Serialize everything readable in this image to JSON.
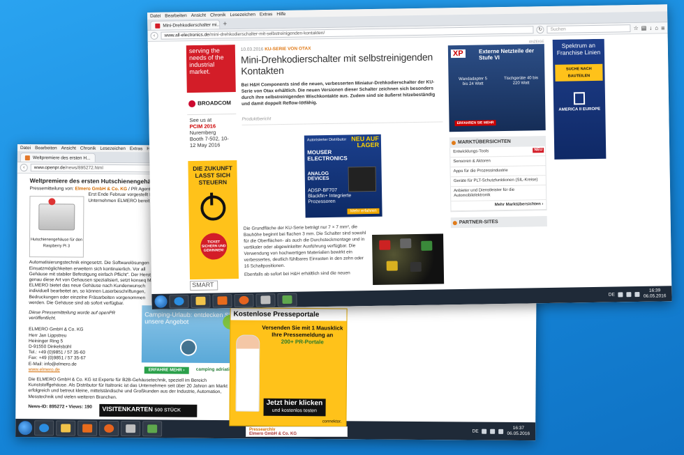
{
  "back": {
    "menu": [
      "Datei",
      "Bearbeiten",
      "Ansicht",
      "Chronik",
      "Lesezeichen",
      "Extras",
      "Hilfe"
    ],
    "tab_title": "Weltpremiere des ersten H...",
    "url_host": "www.openpr.de",
    "url_path": "/news/895272.html",
    "title": "Weltpremiere des ersten Hutschienengehäus",
    "meta_prefix": "Pressemitteilung von:",
    "meta_org": "Elmero GmbH & Co. KG",
    "meta_suffix": "/ PR Agentu",
    "img_caption": "Hutschienengehäuse für den Raspberry Pi 3",
    "para1": "Erst Ende Februar vorgestellt Munde. Die nun dritte Genera bietet dank eines 64-Bit-ARM-Prozessors erhöhte Rechenleistung. Außerdem 4.1., womit er sich besonders (IoT) eignet. Unmittelbar nach Markteinführung Unternehmen ELMERO bereit DIN-Hutschienengehäuse an Jan Lippstreu, Marketingmana Traditionsunternehmen, erklä wird auch zukünftig noch me",
    "para2": "Automatisierungstechnik eingesetzt. Die Softwarelösungen Einsatzmöglichkeiten erweitern sich kontinuierlich. Vor all Gehäuse mit stabiler Befestigung einfach Pflicht\". Der Herst genau diese Art von Gehausen spezialisiert, setzt konseq Markt.",
    "para3": "ELMERO bietet das neue Gehäuse nach Kundenwunsch individuell bearbeitet an, so können Laserbeschriftungen, Bedruckungen oder einzelne Fräsarbeiten vorgenommen werden. Die Gehäuse sind ab sofort verfügbar.",
    "para4": "Diese Pressemitteilung wurde auf openPR veröffentlicht.",
    "address": [
      "ELMERO GmbH & Co. KG",
      "Herr Jan Lippstreu",
      "Heininger Ring 5",
      "D-91550 Dinkelsbühl",
      "Tel.: +49 (0)9851 / 57 35-60",
      "Fax: +49 (0)9851 / 57 35-67",
      "E-Mail: info@elmero.de",
      "www.elmero.de"
    ],
    "para5": "Die ELMERO GmbH & Co. KG ist Experte für B2B-Gehäusetechnik, speziell im Bereich Kunststoffgehäuse. Als Distributor für Italtronic ist das Unternehmen seit über 20 Jahren am Markt erfolgreich und betreut kleine, mittelständische und Großkunden aus der Industrie, Automation, Messtechnik und vielen weiteren Branchen.",
    "news_id": "News-ID: 895272 • Views: 190",
    "ad_text": "Camping-Urlaub: entdecken Sie unsere Angebot",
    "ad_button": "ERFAHRE MEHR ›",
    "ad_brand": "camping adriatic",
    "visitenkarten": "VISITENKARTEN",
    "visitenkarten_sub": "500 STÜCK",
    "tray_lang": "DE",
    "clock_time": "16:37",
    "clock_date": "06.05.2016"
  },
  "front": {
    "menu": [
      "Datei",
      "Bearbeiten",
      "Ansicht",
      "Chronik",
      "Lesezeichen",
      "Extras",
      "Hilfe"
    ],
    "tab_title": "Mini-Drehkodierschalter mi...",
    "url_host": "www.all-electronics.de",
    "url_path": "/mini-drehkodierschalter-mit-selbstreinigenden-kontakten/",
    "search_placeholder": "Suchen",
    "left_red": "serving the needs of the industrial market.",
    "broadcom": "BROADCOM",
    "pcim_pre": "See us at",
    "pcim_name": "PCIM 2016",
    "pcim_city": "Nuremberg",
    "pcim_booth": "Booth 7-502, 10-12 May 2016",
    "zukunft": "DIE ZUKUNFT LASST SICH STEUERN",
    "ticket": "TICKET SICHERN UND GEWINNEN!",
    "smart": "SMART",
    "date": "10.03.2016",
    "category": "KU-SERIE VON OTAX",
    "article_title": "Mini-Drehkodierschalter mit selbstreinigenden Kontakten",
    "lead": "Bei H&H Components sind die neuen, verbesserten Miniatur-Drehkodierschalter der KU-Serie von Otax erhältlich. Die neuen Versionen dieser Schalter zeichnen sich besonders durch ihre selbstreinigenden Wischkontakte aus. Zudem sind sie äußerst hitzebeständig und damit doppelt Reflow-lötfähig.",
    "produkt": "Produktbericht",
    "mouser_top": "Autorisierter Distributor",
    "mouser_neu": "NEU AUF LAGER",
    "mouser_brand": "MOUSER ELECTRONICS",
    "mouser_adi": "ANALOG DEVICES",
    "mouser_prod": "ADSP-BF707 Blackfin+ Integrierte Prozessoren",
    "mouser_btn": "Mehr erfahren",
    "body": "Die Grundfläche der KU-Serie beträgt nur 7 × 7 mm², die Bauhöhe beginnt bei flachen 3 mm. Die Schalter sind sowohl für die Oberflächen- als auch die Durchsteckmontage und in vertikaler oder abgewinkelter Ausführung verfügbar. Die Verwendung von hochwertigen Materialien bewirkt ein verbessertes, deutlich fühlbares Einrasten in den zehn oder 16 Schaltpositionen.",
    "body2": "Ebenfalls ab sofort bei H&H erhältlich sind die neuen",
    "anzeige": "ANZEIGE",
    "xp_title": "Externe Netzteile der Stufe VI",
    "xp_a": "Wandadapter 5 bis 24 Watt",
    "xp_b": "Tischgeräte 40 bis 220 Watt",
    "xp_btn": "ERFAHREN SIE MEHR",
    "markt_title": "MARKTÜBERSICHTEN",
    "markt_items": [
      "Entwicklungs-Tools",
      "Sensoren & Aktoren",
      "Apps für die Prozessindustrie",
      "Geräte für PLT-Schutzfunktionen (SIL-Kreise)",
      "Anbieter und Dienstleister für die Automobilelektronik"
    ],
    "markt_neu": "NEU",
    "markt_more": "Mehr Marktübersichten ›",
    "partner_title": "PARTNER-SITES",
    "right_ad": "Spektrum an Franchise Linien",
    "right_ad_btn": "SUCHE NACH BAUTEILEN",
    "right_ad_brand": "AMERICA II EUROPE",
    "tray_lang": "DE",
    "clock_time": "16:39",
    "clock_date": "06.05.2016"
  },
  "popup": {
    "title": "Kostenlose Presseportale",
    "text": "Versenden Sie mit 1 Mausklick Ihre Pressemeldung an",
    "highlight": "200+ PR-Portale",
    "cta": "Jetzt hier klicken",
    "cta_sub": "und kostenlos testen",
    "brand": "connektor."
  },
  "archiv": {
    "title": "Pressearchiv",
    "org": "Elmero GmbH & Co. KG"
  }
}
